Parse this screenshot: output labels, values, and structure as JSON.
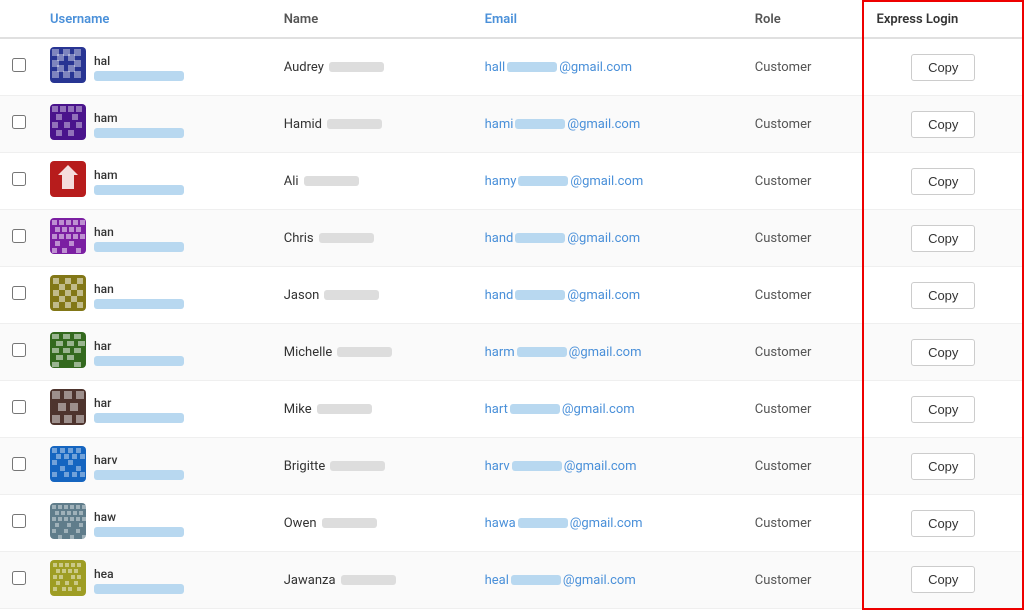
{
  "columns": {
    "username": "Username",
    "name": "Name",
    "email": "Email",
    "role": "Role",
    "express_login": "Express Login"
  },
  "rows": [
    {
      "id": 1,
      "username_prefix": "hal",
      "avatar_color": "#283593",
      "avatar_style": "hal",
      "name_first": "Audrey",
      "email_prefix": "hall",
      "email_redact": true,
      "email_suffix": "@gmail.com",
      "role": "Customer",
      "copy_label": "Copy"
    },
    {
      "id": 2,
      "username_prefix": "ham",
      "avatar_color": "#4a148c",
      "avatar_style": "ham1",
      "name_first": "Hamid",
      "email_prefix": "hami",
      "email_redact": true,
      "email_suffix": "@gmail.com",
      "role": "Customer",
      "copy_label": "Copy"
    },
    {
      "id": 3,
      "username_prefix": "ham",
      "avatar_color": "#b71c1c",
      "avatar_style": "ham2",
      "name_first": "Ali",
      "email_prefix": "hamy",
      "email_redact": true,
      "email_suffix": "@gmail.com",
      "role": "Customer",
      "copy_label": "Copy"
    },
    {
      "id": 4,
      "username_prefix": "han",
      "avatar_color": "#7b1fa2",
      "avatar_style": "han1",
      "name_first": "Chris",
      "email_prefix": "hand",
      "email_redact": true,
      "email_suffix": "@gmail.com",
      "role": "Customer",
      "copy_label": "Copy"
    },
    {
      "id": 5,
      "username_prefix": "han",
      "avatar_color": "#827717",
      "avatar_style": "han2",
      "name_first": "Jason",
      "email_prefix": "hand",
      "email_redact": true,
      "email_suffix": "@gmail.com",
      "role": "Customer",
      "copy_label": "Copy"
    },
    {
      "id": 6,
      "username_prefix": "har",
      "avatar_color": "#33691e",
      "avatar_style": "har1",
      "name_first": "Michelle",
      "email_prefix": "harm",
      "email_redact": true,
      "email_suffix": "@gmail.com",
      "role": "Customer",
      "copy_label": "Copy"
    },
    {
      "id": 7,
      "username_prefix": "har",
      "avatar_color": "#4e342e",
      "avatar_style": "har2",
      "name_first": "Mike",
      "email_prefix": "hart",
      "email_redact": true,
      "email_suffix": "@gmail.com",
      "role": "Customer",
      "copy_label": "Copy"
    },
    {
      "id": 8,
      "username_prefix": "harv",
      "avatar_color": "#1565c0",
      "avatar_style": "harv",
      "name_first": "Brigitte",
      "email_prefix": "harv",
      "email_redact": true,
      "email_suffix": "@gmail.com",
      "role": "Customer",
      "copy_label": "Copy"
    },
    {
      "id": 9,
      "username_prefix": "haw",
      "avatar_color": "#607d8b",
      "avatar_style": "haw",
      "name_first": "Owen",
      "email_prefix": "hawa",
      "email_redact": true,
      "email_suffix": "@gmail.com",
      "role": "Customer",
      "copy_label": "Copy"
    },
    {
      "id": 10,
      "username_prefix": "hea",
      "avatar_color": "#9e9d24",
      "avatar_style": "hea",
      "name_first": "Jawanza",
      "email_prefix": "heal",
      "email_redact": true,
      "email_suffix": "@gmail.com",
      "role": "Customer",
      "copy_label": "Copy"
    }
  ]
}
